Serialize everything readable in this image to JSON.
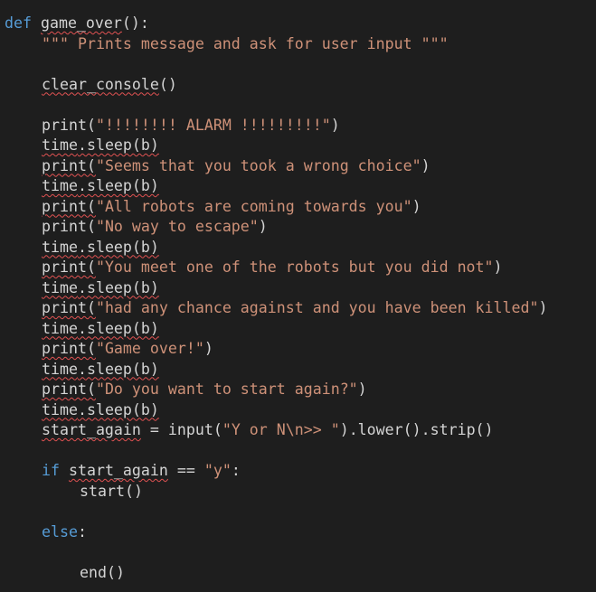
{
  "code": {
    "def_keyword": "def",
    "func_name": "game_over",
    "func_sig_rest": "():",
    "docstring": "\"\"\" Prints message and ask for user input \"\"\"",
    "clear_console_name": "clear_console",
    "clear_console_parens": "()",
    "print_call": "print(",
    "close_paren": ")",
    "sleep_obj": "time",
    "sleep_rest": ".sleep(b)",
    "msg1": "\"!!!!!!!! ALARM !!!!!!!!!\"",
    "msg2": "\"Seems that you took a wrong choice\"",
    "msg3": "\"All robots are coming towards you\"",
    "msg4": "\"No way to escape\"",
    "msg5": "\"You meet one of the robots but you did not\"",
    "msg6": "\"had any chance against and you have been killed\"",
    "msg7": "\"Game over!\"",
    "msg8": "\"Do you want to start again?\"",
    "start_again_var": "start_again",
    "assign_input": " = input(",
    "input_prompt": "\"Y or N\\n>> \"",
    "input_tail": ").lower().strip()",
    "if_keyword": "if",
    "compare_op": " == ",
    "y_literal": "\"y\"",
    "colon": ":",
    "start_call": "start()",
    "else_keyword": "else",
    "end_call": "end()"
  }
}
